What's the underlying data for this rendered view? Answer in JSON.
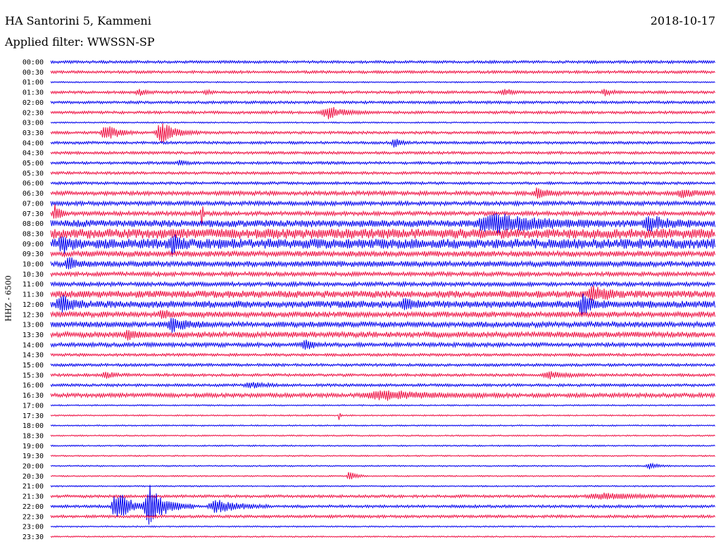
{
  "header": {
    "station": "HA Santorini 5, Kammeni",
    "filter": "Applied filter: WWSSN-SP",
    "date": "2018-10-17"
  },
  "chart_data": {
    "type": "line",
    "title": "HA Santorini 5, Kammeni",
    "subtitle": "Applied filter: WWSSN-SP",
    "date": "2018-10-17",
    "ylabel": "HHZ - 6500",
    "xlabel": "",
    "grid": false,
    "rows": [
      "00:00",
      "00:30",
      "01:00",
      "01:30",
      "02:00",
      "02:30",
      "03:00",
      "03:30",
      "04:00",
      "04:30",
      "05:00",
      "05:30",
      "06:00",
      "06:30",
      "07:00",
      "07:30",
      "08:00",
      "08:30",
      "09:00",
      "09:30",
      "10:00",
      "10:30",
      "11:00",
      "11:30",
      "12:00",
      "12:30",
      "13:00",
      "13:30",
      "14:00",
      "14:30",
      "15:00",
      "15:30",
      "16:00",
      "16:30",
      "17:00",
      "17:30",
      "18:00",
      "18:30",
      "19:00",
      "19:30",
      "20:00",
      "20:30",
      "21:00",
      "21:30",
      "22:00",
      "22:30",
      "23:00",
      "23:30"
    ],
    "row_colors": [
      "#0000ee",
      "#ee1144"
    ],
    "noise_level": [
      2,
      2,
      1,
      2,
      2,
      2,
      1,
      2,
      2,
      2,
      2,
      2,
      2,
      3,
      3,
      3,
      5,
      7,
      7,
      4,
      4,
      3,
      3,
      5,
      5,
      4,
      4,
      4,
      3,
      2,
      2,
      2,
      2,
      3,
      1,
      1,
      1,
      1,
      1,
      1,
      1,
      1,
      1,
      2,
      2,
      2,
      1,
      1
    ],
    "events": [
      {
        "row": 3,
        "minute": 4.0,
        "amplitude": 4,
        "duration": 1.0
      },
      {
        "row": 3,
        "minute": 7.0,
        "amplitude": 4,
        "duration": 0.5
      },
      {
        "row": 3,
        "minute": 20.5,
        "amplitude": 5,
        "duration": 1.0
      },
      {
        "row": 3,
        "minute": 25.0,
        "amplitude": 4,
        "duration": 1.0
      },
      {
        "row": 5,
        "minute": 12.5,
        "amplitude": 9,
        "duration": 2.0
      },
      {
        "row": 7,
        "minute": 2.5,
        "amplitude": 12,
        "duration": 1.5
      },
      {
        "row": 7,
        "minute": 5.0,
        "amplitude": 15,
        "duration": 1.8
      },
      {
        "row": 8,
        "minute": 15.5,
        "amplitude": 6,
        "duration": 0.8
      },
      {
        "row": 10,
        "minute": 5.8,
        "amplitude": 5,
        "duration": 0.6
      },
      {
        "row": 13,
        "minute": 22.0,
        "amplitude": 9,
        "duration": 1.0
      },
      {
        "row": 13,
        "minute": 28.5,
        "amplitude": 6,
        "duration": 1.5
      },
      {
        "row": 15,
        "minute": 0.2,
        "amplitude": 15,
        "duration": 0.6
      },
      {
        "row": 15,
        "minute": 6.8,
        "amplitude": 22,
        "duration": 0.2
      },
      {
        "row": 16,
        "minute": 20.0,
        "amplitude": 14,
        "duration": 5.0
      },
      {
        "row": 16,
        "minute": 27.0,
        "amplitude": 10,
        "duration": 2.0
      },
      {
        "row": 18,
        "minute": 0.5,
        "amplitude": 12,
        "duration": 1.0
      },
      {
        "row": 18,
        "minute": 5.5,
        "amplitude": 14,
        "duration": 0.8
      },
      {
        "row": 20,
        "minute": 0.8,
        "amplitude": 10,
        "duration": 1.0
      },
      {
        "row": 23,
        "minute": 24.5,
        "amplitude": 10,
        "duration": 1.5
      },
      {
        "row": 24,
        "minute": 0.5,
        "amplitude": 11,
        "duration": 1.5
      },
      {
        "row": 24,
        "minute": 16.0,
        "amplitude": 8,
        "duration": 1.0
      },
      {
        "row": 24,
        "minute": 24.0,
        "amplitude": 16,
        "duration": 1.2
      },
      {
        "row": 25,
        "minute": 5.0,
        "amplitude": 6,
        "duration": 0.8
      },
      {
        "row": 26,
        "minute": 5.5,
        "amplitude": 10,
        "duration": 1.5
      },
      {
        "row": 27,
        "minute": 3.5,
        "amplitude": 7,
        "duration": 1.0
      },
      {
        "row": 28,
        "minute": 11.5,
        "amplitude": 9,
        "duration": 1.0
      },
      {
        "row": 31,
        "minute": 2.5,
        "amplitude": 4,
        "duration": 1.5
      },
      {
        "row": 31,
        "minute": 22.5,
        "amplitude": 5,
        "duration": 2.0
      },
      {
        "row": 32,
        "minute": 9.0,
        "amplitude": 4,
        "duration": 2.0
      },
      {
        "row": 33,
        "minute": 15.0,
        "amplitude": 6,
        "duration": 6.0
      },
      {
        "row": 35,
        "minute": 13.0,
        "amplitude": 10,
        "duration": 0.15
      },
      {
        "row": 40,
        "minute": 27.0,
        "amplitude": 5,
        "duration": 1.0
      },
      {
        "row": 41,
        "minute": 13.5,
        "amplitude": 9,
        "duration": 0.8
      },
      {
        "row": 43,
        "minute": 25.0,
        "amplitude": 4,
        "duration": 5.0
      },
      {
        "row": 44,
        "minute": 3.0,
        "amplitude": 26,
        "duration": 1.5
      },
      {
        "row": 44,
        "minute": 4.5,
        "amplitude": 32,
        "duration": 2.0
      },
      {
        "row": 44,
        "minute": 7.5,
        "amplitude": 10,
        "duration": 2.5
      }
    ]
  }
}
